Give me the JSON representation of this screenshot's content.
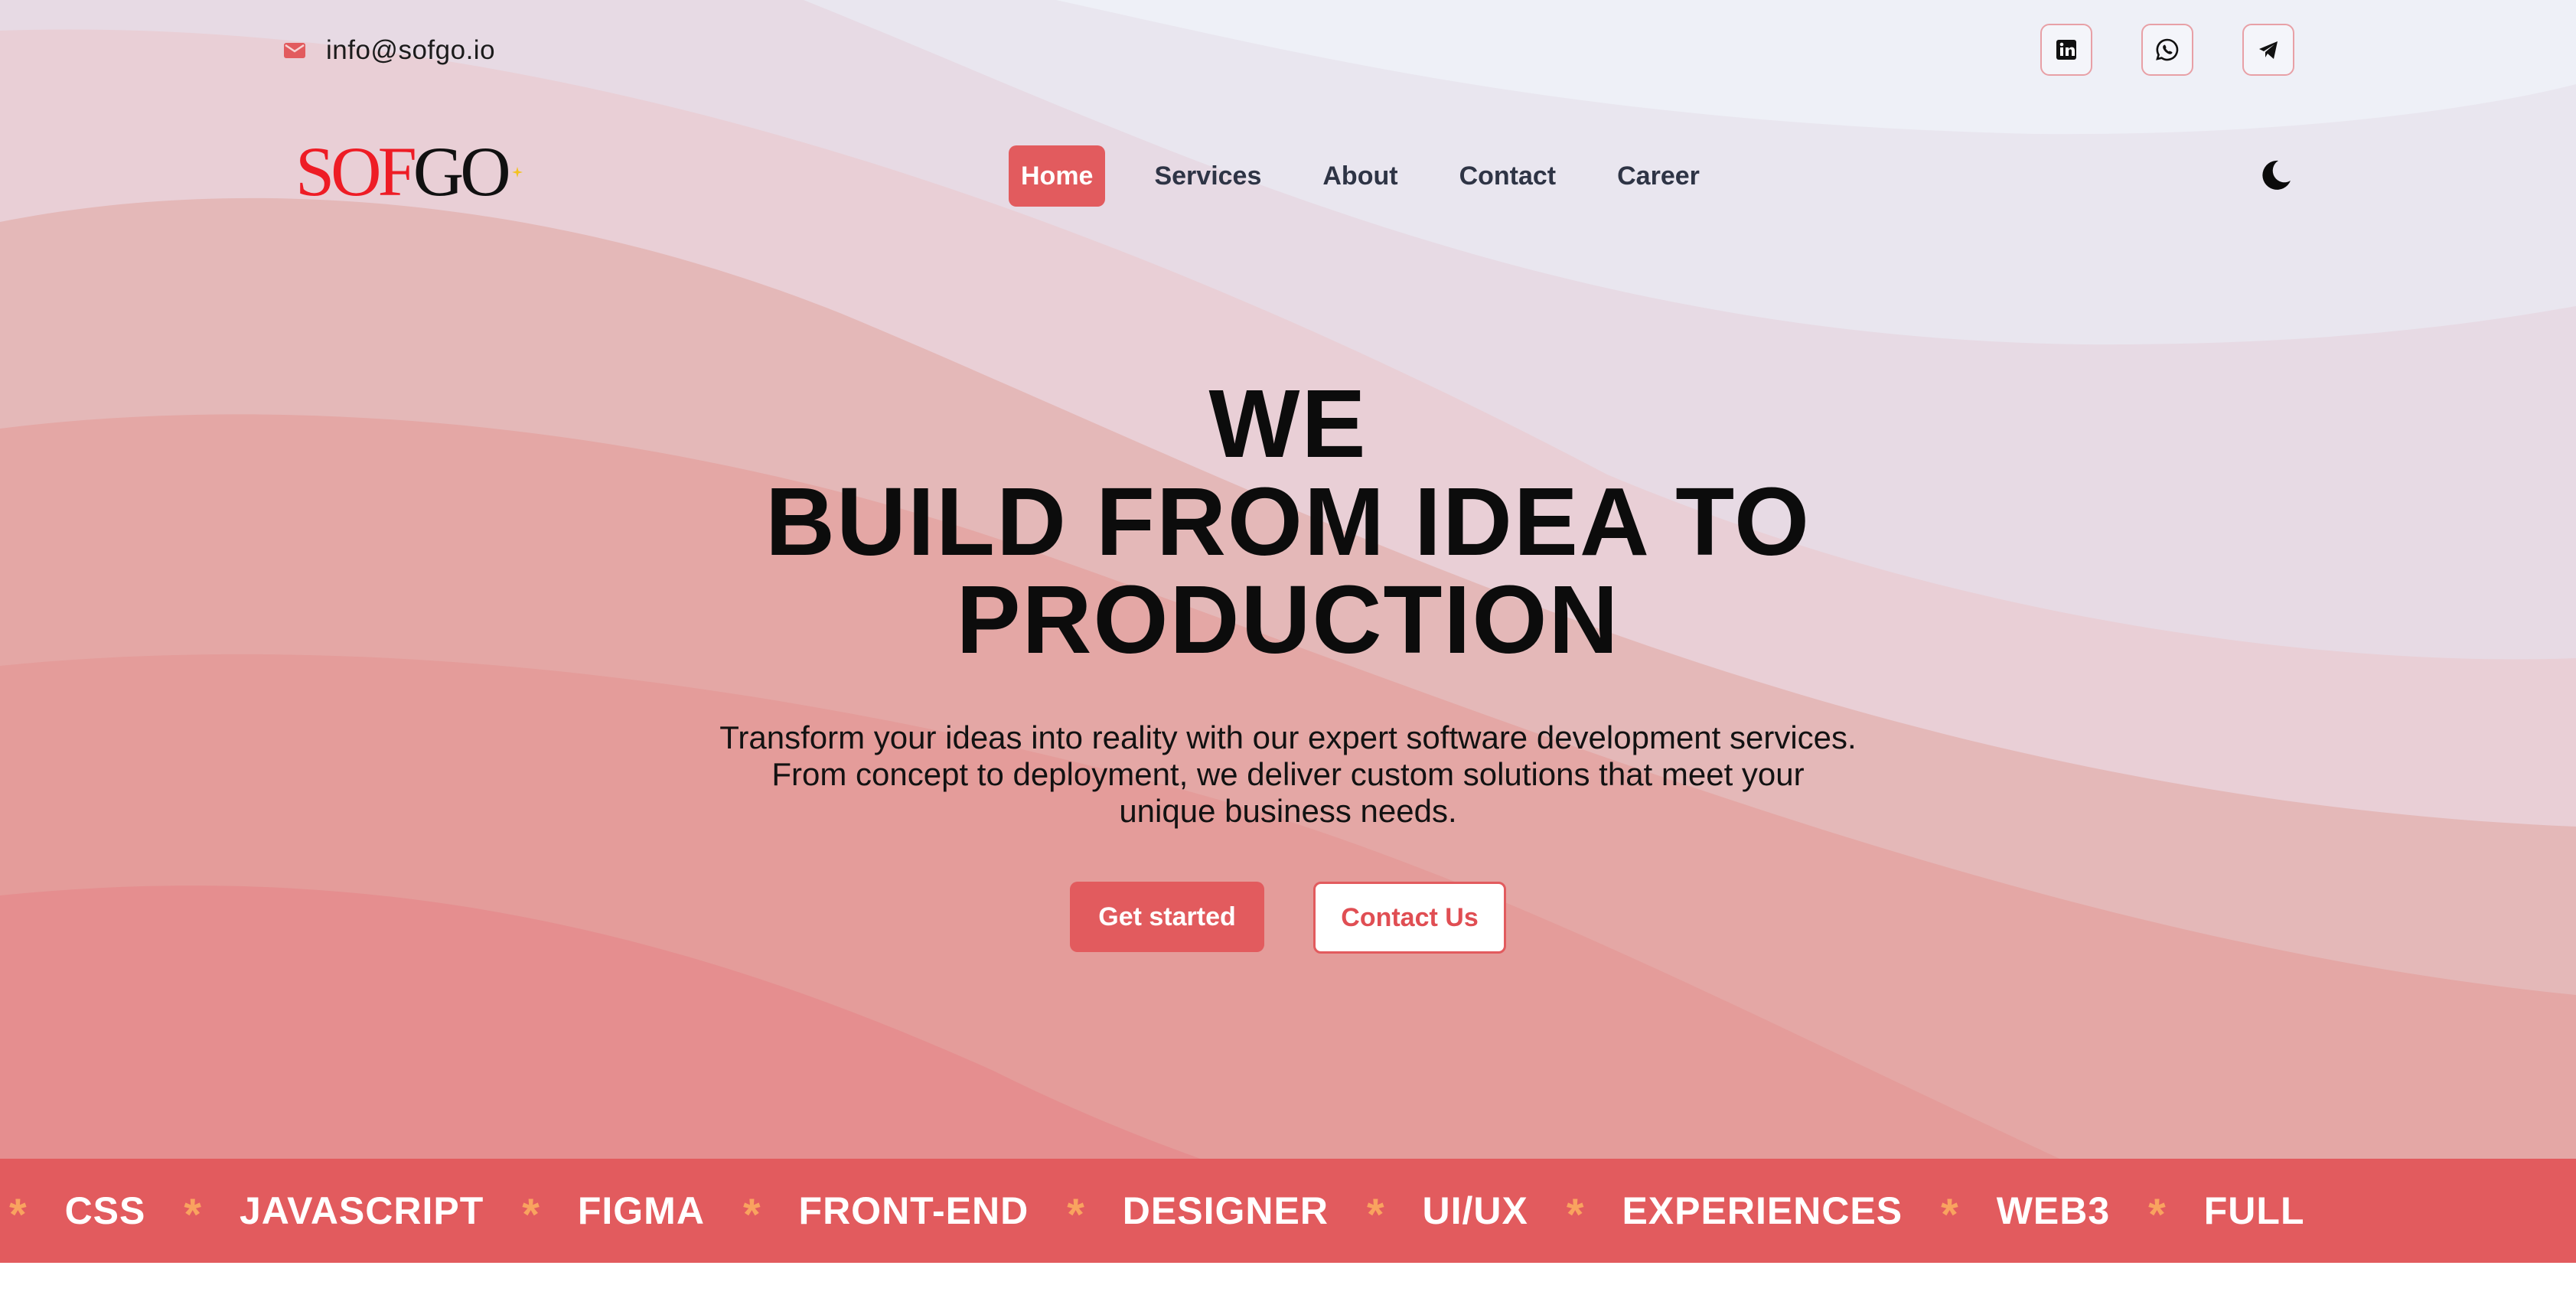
{
  "topbar": {
    "email": "info@sofgo.io",
    "email_icon": "mail-icon",
    "socials": [
      {
        "name": "linkedin-icon"
      },
      {
        "name": "whatsapp-icon"
      },
      {
        "name": "telegram-icon"
      }
    ]
  },
  "logo": {
    "part1": "SOF",
    "part2": "GO"
  },
  "nav": {
    "items": [
      "Home",
      "Services",
      "About",
      "Contact",
      "Career"
    ],
    "active": "Home"
  },
  "theme_toggle": {
    "icon": "moon-icon"
  },
  "hero": {
    "title_lines": [
      "WE",
      "BUILD FROM IDEA TO",
      "PRODUCTION"
    ],
    "subtitle_lines": [
      "Transform your ideas into reality with our expert software development services.",
      "From concept to deployment, we deliver custom solutions that meet your",
      "unique business needs."
    ],
    "primary_cta": "Get started",
    "secondary_cta": "Contact Us"
  },
  "marquee": {
    "separator": "*",
    "tags": [
      "CSS",
      "JAVASCRIPT",
      "FIGMA",
      "FRONT-END",
      "DESIGNER",
      "UI/UX",
      "EXPERIENCES",
      "WEB3",
      "FULL"
    ]
  },
  "colors": {
    "accent": "#e25b5e",
    "star": "#f9a35f",
    "text_dark": "#0c0c0c",
    "nav_text": "#2e3445"
  }
}
